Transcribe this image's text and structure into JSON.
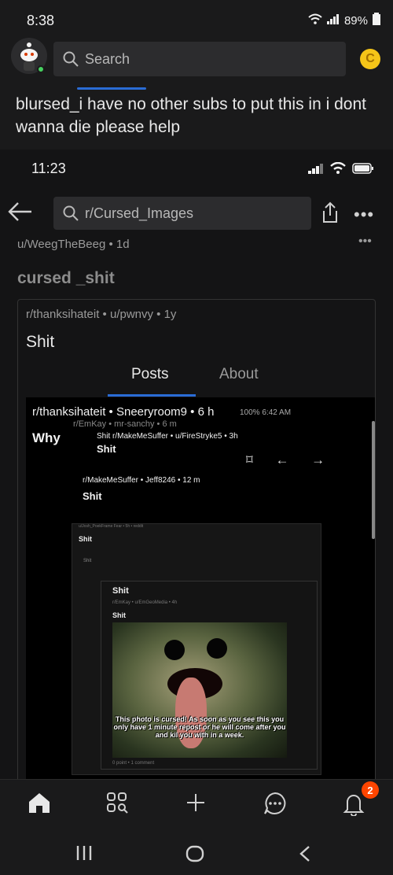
{
  "status_bar": {
    "time": "8:38",
    "battery": "89%"
  },
  "header": {
    "search_placeholder": "Search"
  },
  "post": {
    "title": "blursed_i have no other subs to put this in i dont wanna die please help"
  },
  "inner": {
    "status_time": "11:23",
    "search_text": "r/Cursed_Images",
    "meta": "u/WeegTheBeeg • 1d",
    "title": "cursed _shit",
    "card": {
      "meta": "r/thanksihateit • u/pwnvy • 1y",
      "title": "Shit",
      "tabs": [
        "Posts",
        "About"
      ],
      "nested": {
        "line1": "r/thanksihateit • Sneeryroom9 • 6 h",
        "line1_sub": "r/EmKay • mr-sanchy • 6 m",
        "line1_status": "100% 6:42 AM",
        "line2": "Why",
        "line3": "Shit   r/MakeMeSuffer • u/FireStryke5 • 3h",
        "line4": "Shit",
        "line5": "r/MakeMeSuffer • Jeff8246 • 12 m",
        "line6": "Shit",
        "inner_title": "Shit",
        "inner_hdr": "u/Josh_PoekFrame Fear • 5h • reddit",
        "inner_row1": "Shit",
        "inner_card_title": "Shit",
        "inner_card_meta": "r/EmKay • u/EmGeoMedia • 4h",
        "inner_card_title2": "Shit",
        "caption": "This photo is cursed! As soon as you see this you only have 1 minute repost or he will come after you and kil you with in a week.",
        "footer": "0 point • 1 comment"
      }
    }
  },
  "bottom_nav": {
    "badge": "2"
  },
  "colors": {
    "accent": "#2a6cd6",
    "badge": "#ff4500",
    "online": "#46d160",
    "coin": "#f5c518"
  }
}
